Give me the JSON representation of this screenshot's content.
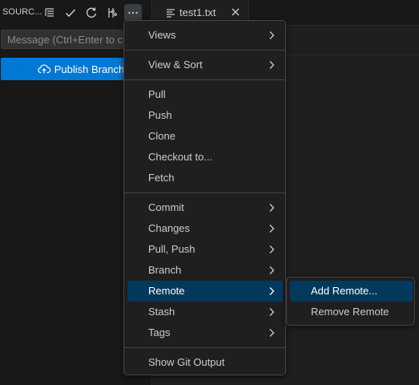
{
  "sidebar": {
    "title": "SOURC...",
    "header_icons": [
      "view-as-tree-icon",
      "check-icon",
      "refresh-icon",
      "commit-graph-icon",
      "more-actions-icon"
    ],
    "commit_message": {
      "value": "",
      "placeholder": "Message (Ctrl+Enter to commit)"
    },
    "publish_label": "Publish Branch",
    "publish_icon": "cloud-upload-icon"
  },
  "editor": {
    "tab": {
      "label": "test1.txt",
      "icon": "file-lines-icon",
      "close_icon": "close-icon"
    }
  },
  "context_menu": {
    "groups": [
      [
        {
          "label": "Views",
          "submenu": true
        }
      ],
      [
        {
          "label": "View & Sort",
          "submenu": true
        }
      ],
      [
        {
          "label": "Pull",
          "submenu": false
        },
        {
          "label": "Push",
          "submenu": false
        },
        {
          "label": "Clone",
          "submenu": false
        },
        {
          "label": "Checkout to...",
          "submenu": false
        },
        {
          "label": "Fetch",
          "submenu": false
        }
      ],
      [
        {
          "label": "Commit",
          "submenu": true
        },
        {
          "label": "Changes",
          "submenu": true
        },
        {
          "label": "Pull, Push",
          "submenu": true
        },
        {
          "label": "Branch",
          "submenu": true
        },
        {
          "label": "Remote",
          "submenu": true,
          "active": true
        },
        {
          "label": "Stash",
          "submenu": true
        },
        {
          "label": "Tags",
          "submenu": true
        }
      ],
      [
        {
          "label": "Show Git Output",
          "submenu": false
        }
      ]
    ]
  },
  "remote_submenu": {
    "items": [
      {
        "label": "Add Remote...",
        "active": true
      },
      {
        "label": "Remove Remote",
        "active": false
      }
    ]
  },
  "colors": {
    "accent": "#0078d4",
    "menu_active": "#04395e",
    "background": "#1f1f1f",
    "sidebar": "#181818"
  }
}
